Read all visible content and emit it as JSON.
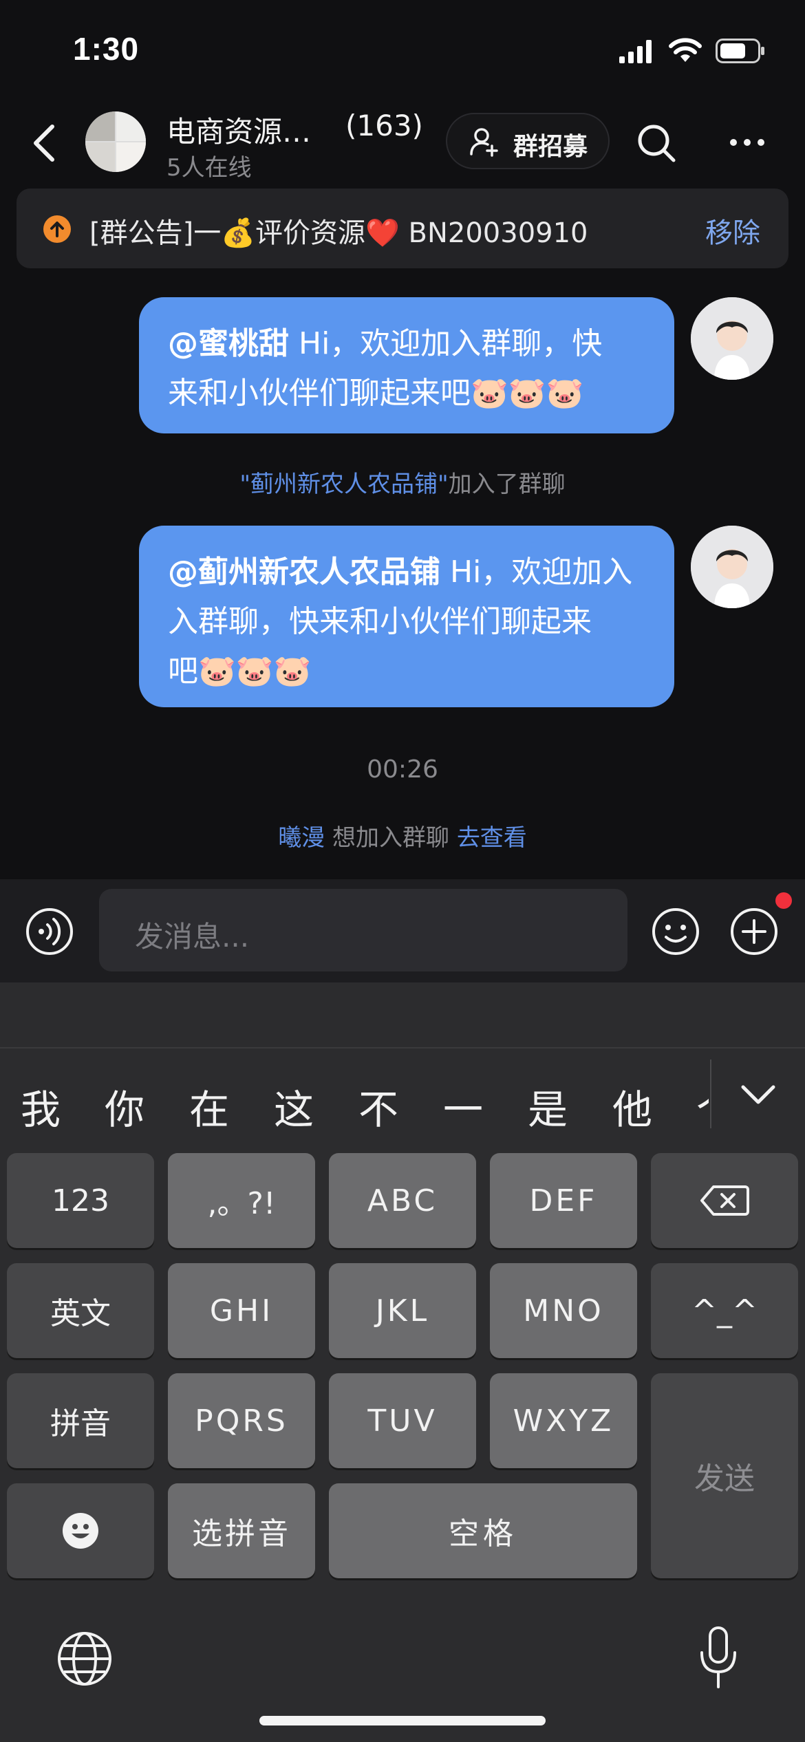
{
  "status_bar": {
    "time": "1:30"
  },
  "header": {
    "title": "电商资源…",
    "member_count": "(163)",
    "online": "5人在线",
    "recruit_label": "群招募"
  },
  "notice": {
    "text": "[群公告]一💰评价资源❤️ BN20030910",
    "remove_label": "移除"
  },
  "messages": {
    "m1": {
      "mention": "@蜜桃甜",
      "line1_rest": " Hi，欢迎加入群聊，快",
      "line2": "来和小伙伴们聊起来吧🐷🐷🐷"
    },
    "join_notice": {
      "quote_open": "\"",
      "name": "蓟州新农人农品铺",
      "quote_close": "\"",
      "suffix": "加入了群聊"
    },
    "m2": {
      "mention": "@蓟州新农人农品铺",
      "line1_rest": " Hi，欢迎加入",
      "line2": "入群聊，快来和小伙伴们聊起来",
      "line3": "吧🐷🐷🐷"
    },
    "time": "00:26",
    "request": {
      "name": "曦漫",
      "middle": " 想加入群聊 ",
      "action": "去查看"
    }
  },
  "input": {
    "placeholder": "发消息..."
  },
  "keyboard": {
    "candidates": [
      "我",
      "你",
      "在",
      "这",
      "不",
      "一",
      "是",
      "他",
      "个"
    ],
    "row1": [
      "123",
      ",。?!",
      "ABC",
      "DEF"
    ],
    "row2": [
      "英文",
      "GHI",
      "JKL",
      "MNO",
      "^_^"
    ],
    "row3": [
      "拼音",
      "PQRS",
      "TUV",
      "WXYZ"
    ],
    "row4": [
      "选拼音",
      "空格"
    ],
    "send": "发送"
  },
  "colors": {
    "bubble": "#5b96ef",
    "link": "#5f8fe6",
    "background": "#101012"
  }
}
